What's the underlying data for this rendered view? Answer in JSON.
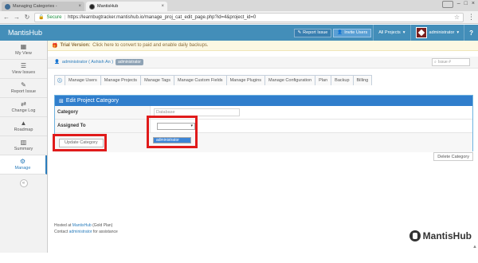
{
  "browser": {
    "tabs": [
      {
        "label": "Managing Categories -"
      },
      {
        "label": "MantisHub"
      }
    ],
    "secure_label": "Secure",
    "url": "https://learnbugtracker.mantishub.io/manage_proj_cat_edit_page.php?id=4&project_id=0"
  },
  "navbar": {
    "brand": "MantisHub",
    "report_issue": "Report Issue",
    "invite_users": "Invite Users",
    "all_projects": "All Projects",
    "user": "administrator",
    "help": "?"
  },
  "sidebar": {
    "items": [
      {
        "label": "My View",
        "icon": "dashboard-icon"
      },
      {
        "label": "View Issues",
        "icon": "list-icon"
      },
      {
        "label": "Report Issue",
        "icon": "edit-icon"
      },
      {
        "label": "Change Log",
        "icon": "retweet-icon"
      },
      {
        "label": "Roadmap",
        "icon": "road-icon"
      },
      {
        "label": "Summary",
        "icon": "bar-chart-icon"
      },
      {
        "label": "Manage",
        "icon": "gears-icon"
      }
    ]
  },
  "trial": {
    "label": "Trial Version:",
    "message": "Click here to convert to paid and enable daily backups."
  },
  "breadcrumb": {
    "user": "administrator ( Ashish An )",
    "badge": "administrator",
    "search_placeholder": "Issue #"
  },
  "tabs": [
    "Manage Users",
    "Manage Projects",
    "Manage Tags",
    "Manage Custom Fields",
    "Manage Plugins",
    "Manage Configuration",
    "Plan",
    "Backup",
    "Billing"
  ],
  "form": {
    "title": "Edit Project Category",
    "category_label": "Category",
    "category_value": "Database",
    "assigned_label": "Assigned To",
    "assigned_option": "administrator",
    "update_button": "Update Category",
    "delete_button": "Delete Category"
  },
  "footer": {
    "hosted_prefix": "Hosted at",
    "hosted_link": "MantisHub",
    "hosted_suffix": "(Gold Plan)",
    "contact_prefix": "Contact",
    "contact_link": "administrator",
    "contact_suffix": "for assistance",
    "logo": "MantisHub"
  },
  "colors": {
    "navbar": "#438eb9",
    "panel_header": "#307ecc",
    "highlight": "#e01b1b"
  }
}
